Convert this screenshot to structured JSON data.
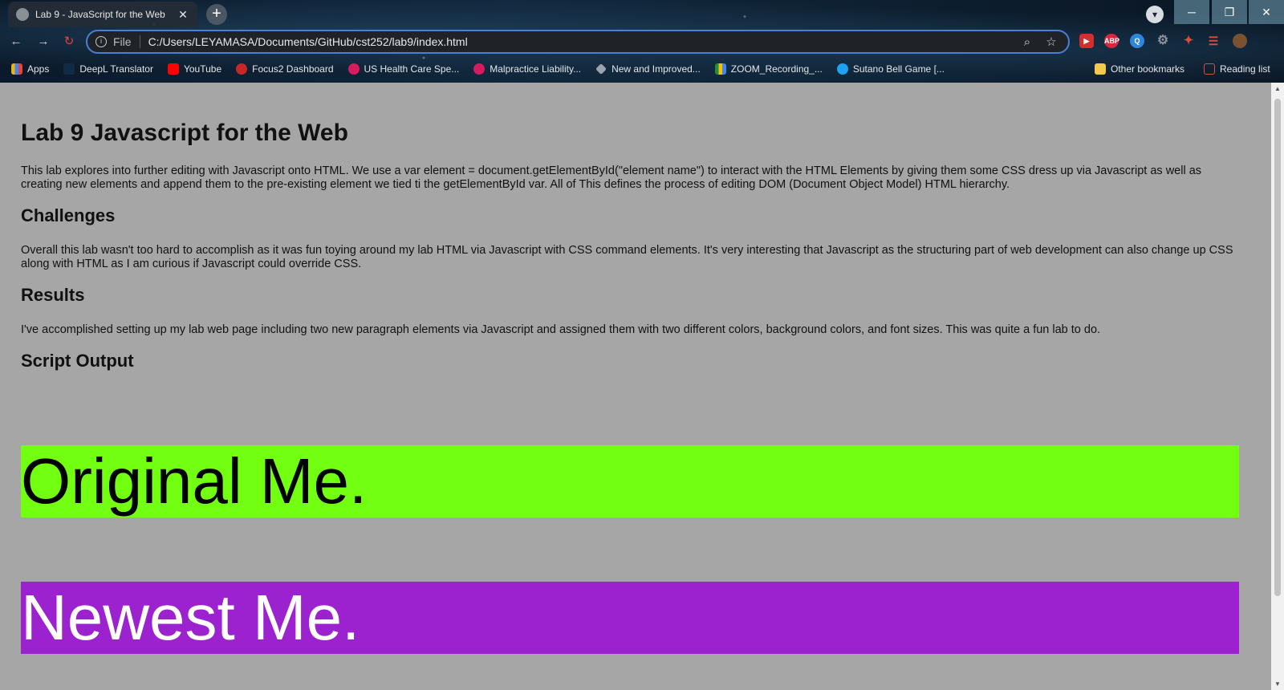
{
  "browser": {
    "tab_title": "Lab 9 - JavaScript for the Web",
    "tab_close": "✕",
    "new_tab": "+",
    "address": {
      "scheme_label": "File",
      "url": "C:/Users/LEYAMASA/Documents/GitHub/cst252/lab9/index.html"
    },
    "extensions": [
      "ABP"
    ],
    "bookmarks": [
      {
        "label": "Apps",
        "color": "#e8b317"
      },
      {
        "label": "DeepL Translator",
        "color": "#0f2b46"
      },
      {
        "label": "YouTube",
        "color": "#ff0000"
      },
      {
        "label": "Focus2 Dashboard",
        "color": "#c62828"
      },
      {
        "label": "US Health Care Spe...",
        "color": "#d81b60"
      },
      {
        "label": "Malpractice Liability...",
        "color": "#d81b60"
      },
      {
        "label": "New and Improved...",
        "color": "#9aa4b0"
      },
      {
        "label": "ZOOM_Recording_...",
        "color": "#1e8e3e"
      },
      {
        "label": "Sutano Bell Game [...",
        "color": "#1da1f2"
      }
    ],
    "other_bookmarks": "Other bookmarks",
    "reading_list": "Reading list"
  },
  "page": {
    "title": "Lab 9 Javascript for the Web",
    "intro": "This lab explores into further editing with Javascript onto HTML. We use a var element = document.getElementById(\"element name\") to interact with the HTML Elements by giving them some CSS dress up via Javascript as well as creating new elements and append them to the pre-existing element we tied ti the getElementById var. All of This defines the process of editing DOM (Document Object Model) HTML hierarchy.",
    "challenges_heading": "Challenges",
    "challenges_text": "Overall this lab wasn't too hard to accomplish as it was fun toying around my lab HTML via Javascript with CSS command elements. It's very interesting that Javascript as the structuring part of web development can also change up CSS along with HTML as I am curious if Javascript could override CSS.",
    "results_heading": "Results",
    "results_text": "I've accomplished setting up my lab web page including two new paragraph elements via Javascript and assigned them with two different colors, background colors, and font sizes. This was quite a fun lab to do.",
    "script_heading": "Script Output",
    "output_original": "Original Me.",
    "output_newest": "Newest Me."
  },
  "colors": {
    "page_bg": "#a6a6a6",
    "original_bg": "#72ff12",
    "newest_bg": "#9b22ce",
    "omnibox_border": "#4b7fd6"
  }
}
